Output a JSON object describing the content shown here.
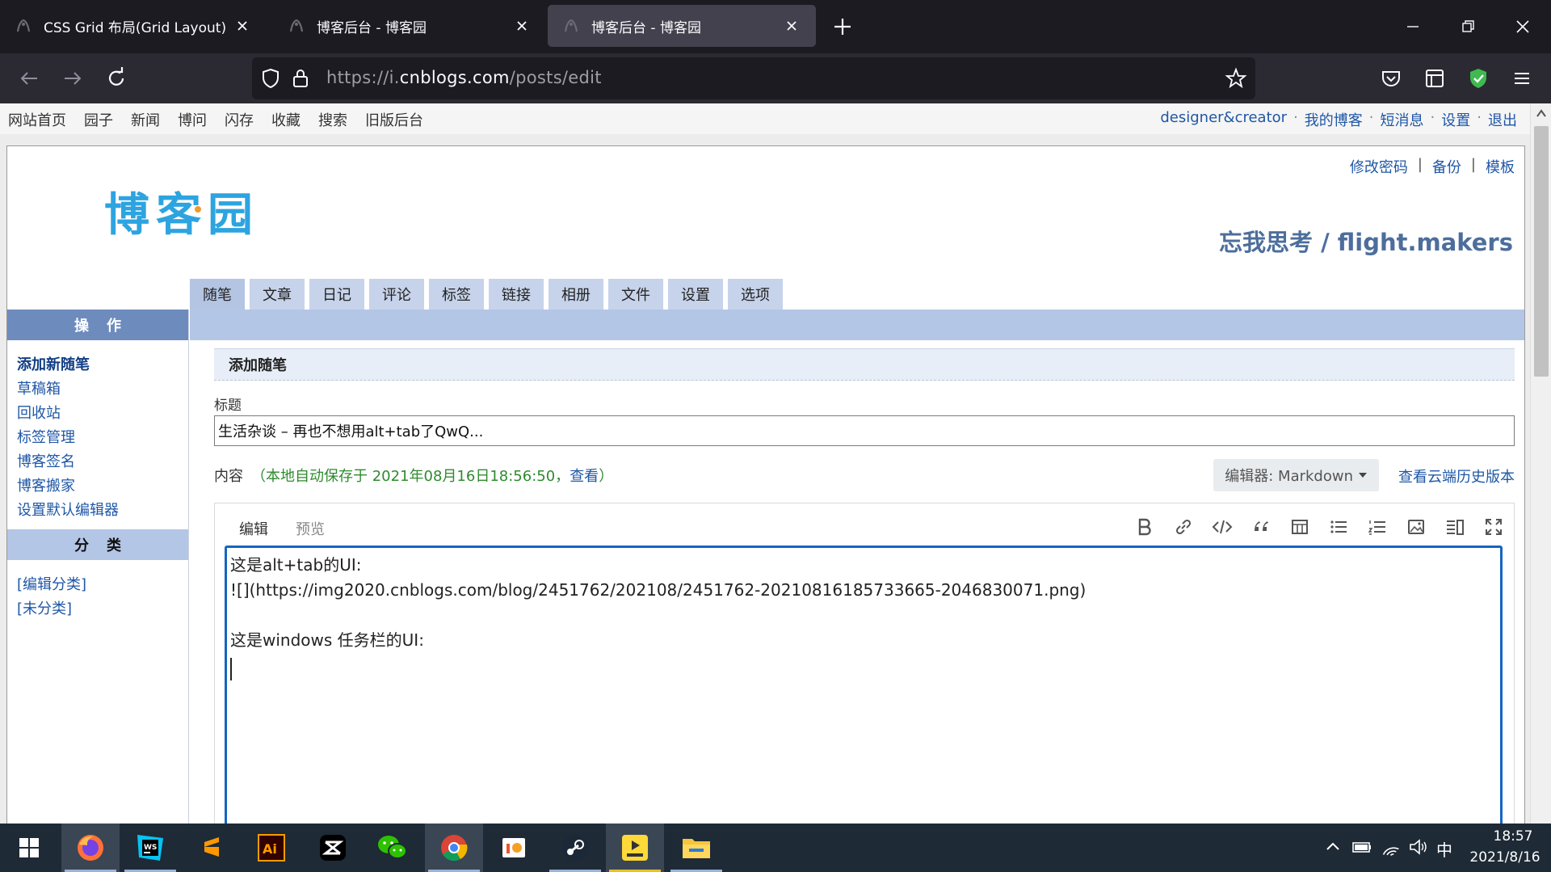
{
  "browser": {
    "tabs": [
      {
        "title": "CSS Grid 布局(Grid Layout)完全",
        "active": false
      },
      {
        "title": "博客后台 - 博客园",
        "active": false
      },
      {
        "title": "博客后台 - 博客园",
        "active": true
      }
    ],
    "url_prefix": "https://i.",
    "url_host": "cnblogs.com",
    "url_path": "/posts/edit"
  },
  "topnav": {
    "left": [
      "网站首页",
      "园子",
      "新闻",
      "博问",
      "闪存",
      "收藏",
      "搜索",
      "旧版后台"
    ],
    "user": "designer&creator",
    "right": [
      "我的博客",
      "短消息",
      "设置",
      "退出"
    ],
    "dot": "·"
  },
  "header": {
    "top_links": [
      "修改密码",
      "备份",
      "模板"
    ],
    "bar": "|",
    "logo_text": "博客园",
    "blog_title": "忘我思考 / flight.makers"
  },
  "nav_tabs": [
    "随笔",
    "文章",
    "日记",
    "评论",
    "标签",
    "链接",
    "相册",
    "文件",
    "设置",
    "选项"
  ],
  "sidebar": {
    "ops_title": "操作",
    "ops": [
      "添加新随笔",
      "草稿箱",
      "回收站",
      "标签管理",
      "博客签名",
      "博客搬家",
      "设置默认编辑器"
    ],
    "cat_title": "分类",
    "cats": [
      "[编辑分类]",
      "[未分类]"
    ]
  },
  "form": {
    "section_title": "添加随笔",
    "title_label": "标题",
    "title_value": "生活杂谈 – 再也不想用alt+tab了QwQ...",
    "content_label": "内容",
    "autosave_text": "（本地自动保存于 2021年08月16日18:56:50，",
    "autosave_view": "查看",
    "autosave_close": "）",
    "editor_select": "编辑器: Markdown",
    "history_link": "查看云端历史版本",
    "editor_tabs": [
      "编辑",
      "预览"
    ],
    "toolbar_icons": [
      "bold-icon",
      "link-icon",
      "code-icon",
      "quote-icon",
      "table-icon",
      "unordered-list-icon",
      "ordered-list-icon",
      "image-icon",
      "split-view-icon",
      "fullscreen-icon"
    ],
    "content_lines": [
      "这是alt+tab的UI:",
      "![](https://img2020.cnblogs.com/blog/2451762/202108/2451762-20210816185733665-2046830071.png)",
      "",
      "这是windows 任务栏的UI:",
      ""
    ]
  },
  "taskbar": {
    "apps": [
      "start-icon",
      "firefox-icon",
      "webstorm-icon",
      "sublime-icon",
      "illustrator-icon",
      "capcut-icon",
      "wechat-icon",
      "chrome-icon",
      "office-icon",
      "steam-icon",
      "player-icon",
      "explorer-icon"
    ],
    "ime": "中",
    "time": "18:57",
    "date": "2021/8/16"
  }
}
